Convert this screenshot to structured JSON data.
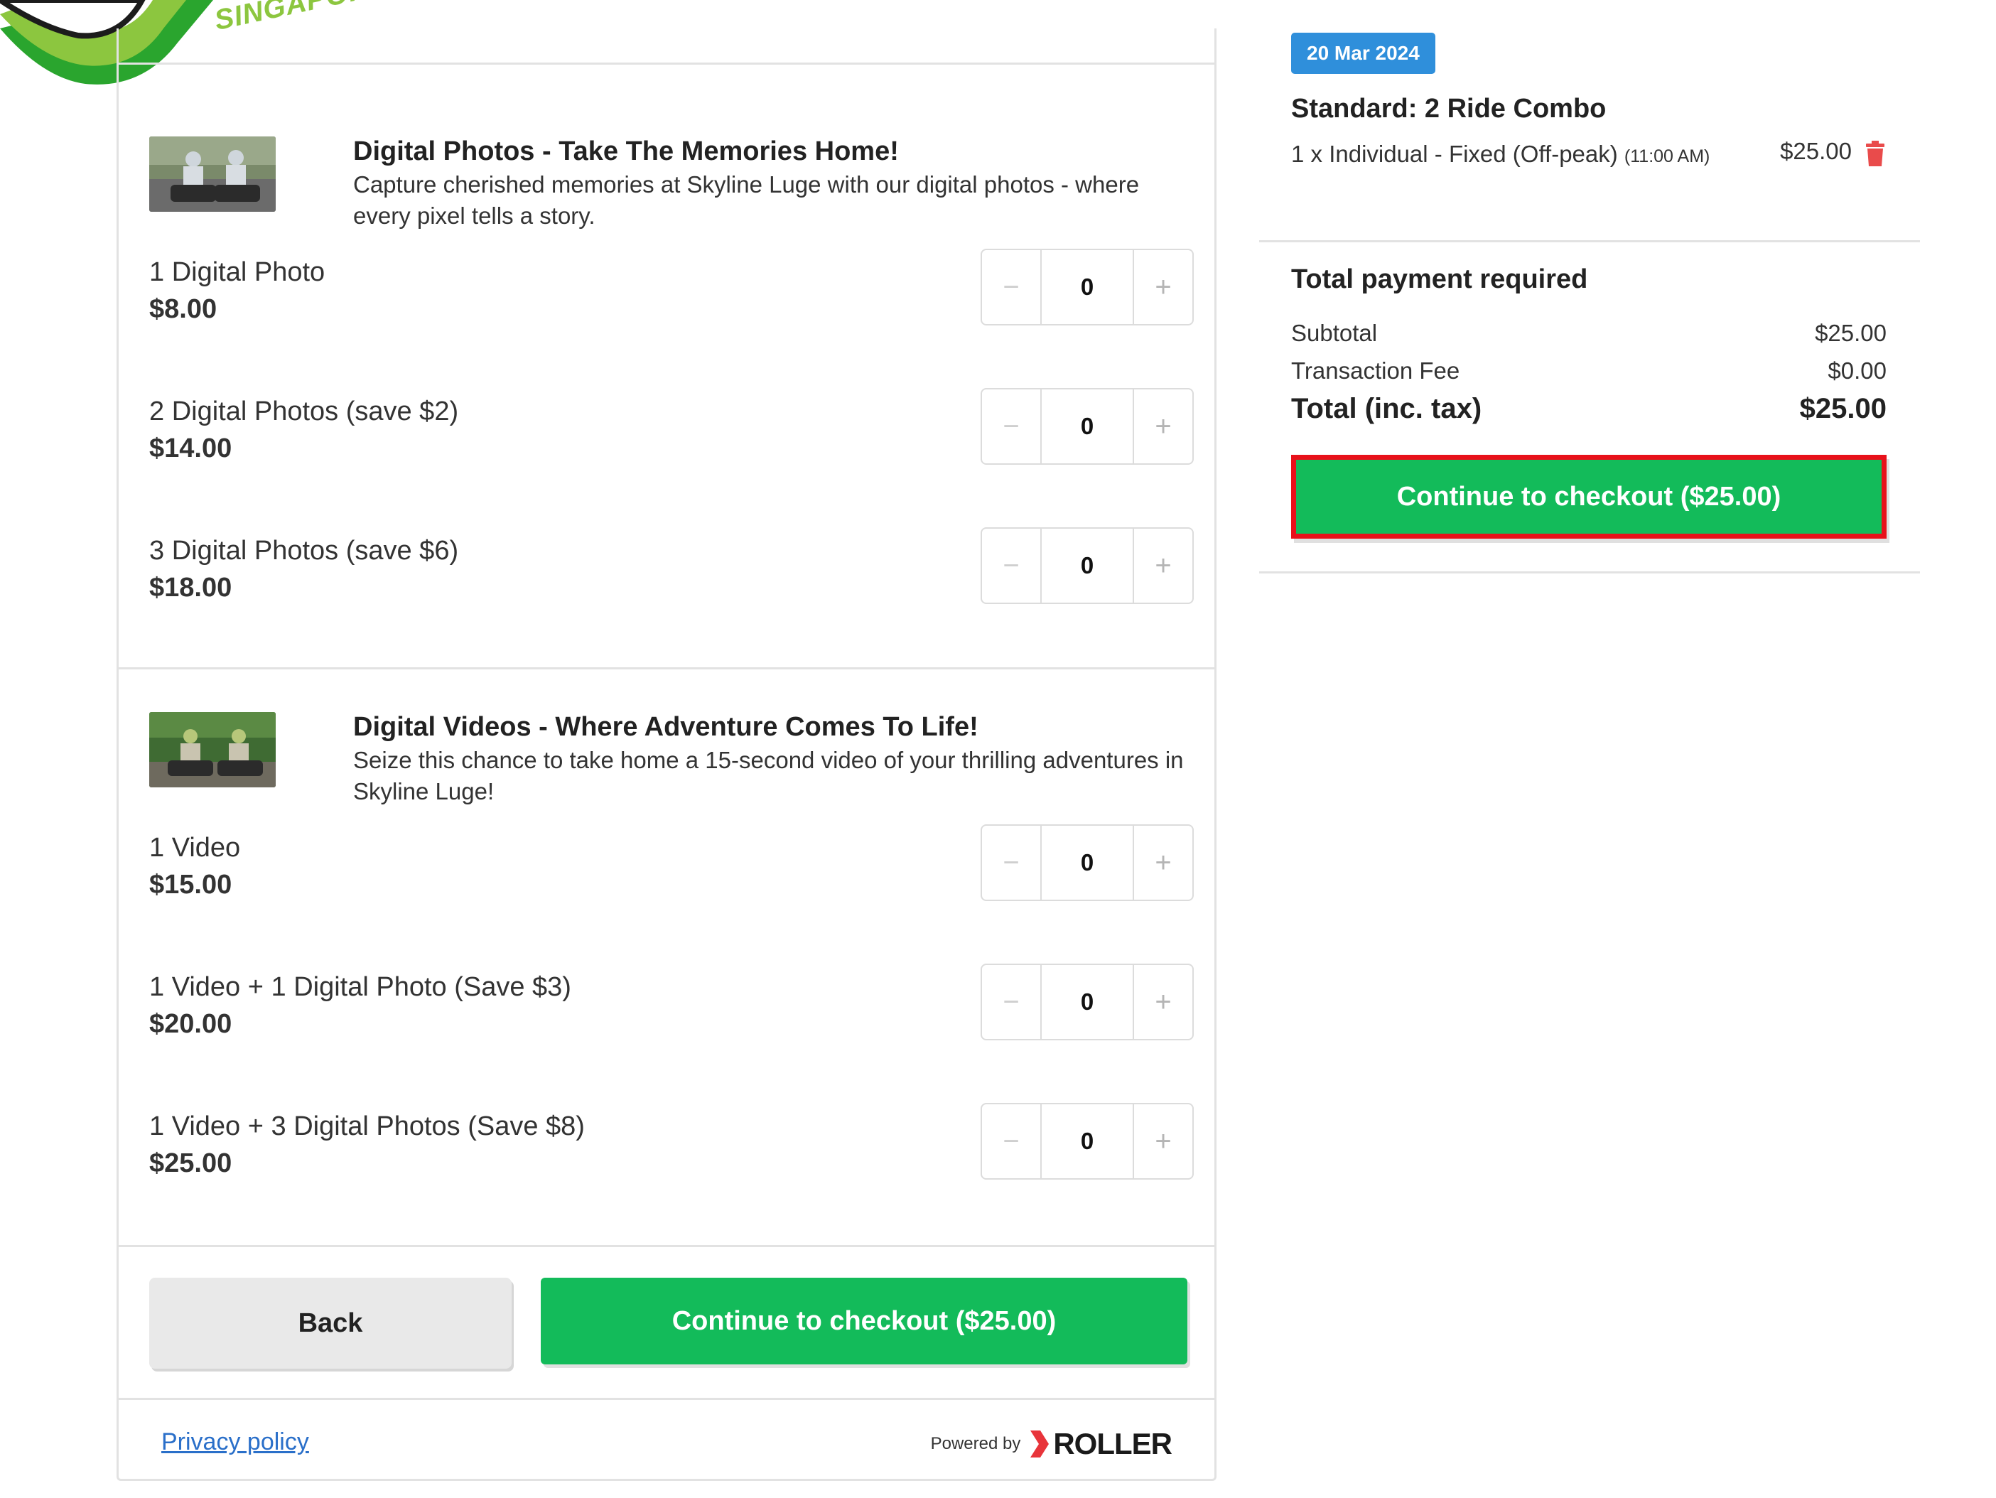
{
  "brand": {
    "logo_text": "SINGAPORE"
  },
  "sections": [
    {
      "title": "Digital Photos - Take The Memories Home!",
      "description": "Capture cherished memories at Skyline Luge with our digital photos - where every pixel tells a story.",
      "items": [
        {
          "name": "1 Digital Photo",
          "price": "$8.00",
          "qty": "0"
        },
        {
          "name": "2 Digital Photos (save $2)",
          "price": "$14.00",
          "qty": "0"
        },
        {
          "name": "3 Digital Photos (save $6)",
          "price": "$18.00",
          "qty": "0"
        }
      ]
    },
    {
      "title": "Digital Videos - Where Adventure Comes To Life!",
      "description": "Seize this chance to take home a 15-second video of your thrilling adventures in Skyline Luge!",
      "items": [
        {
          "name": "1 Video",
          "price": "$15.00",
          "qty": "0"
        },
        {
          "name": "1 Video + 1 Digital Photo (Save $3)",
          "price": "$20.00",
          "qty": "0"
        },
        {
          "name": "1 Video + 3 Digital Photos (Save $8)",
          "price": "$25.00",
          "qty": "0"
        }
      ]
    }
  ],
  "stepper": {
    "minus": "−",
    "plus": "+"
  },
  "actions": {
    "back_label": "Back",
    "checkout_label": "Continue to checkout ($25.00)"
  },
  "footer": {
    "privacy_label": "Privacy policy",
    "powered_by": "Powered by",
    "vendor": "ROLLER"
  },
  "cart": {
    "date": "20 Mar 2024",
    "product": "Standard: 2 Ride Combo",
    "line_desc": "1 x Individual - Fixed (Off-peak)",
    "line_time": "(11:00 AM)",
    "line_price": "$25.00",
    "payment_title": "Total payment required",
    "subtotal_label": "Subtotal",
    "subtotal_value": "$25.00",
    "fee_label": "Transaction Fee",
    "fee_value": "$0.00",
    "total_label": "Total (inc. tax)",
    "total_value": "$25.00",
    "checkout_label": "Continue to checkout ($25.00)"
  },
  "colors": {
    "accent_green": "#13bb5a",
    "badge_blue": "#2f8fdb",
    "highlight_red": "#e8111a",
    "delete_red": "#e94b4b",
    "link_blue": "#2a6fc9"
  },
  "icons": {
    "delete": "trash-icon",
    "roller": "roller-logo-icon"
  }
}
